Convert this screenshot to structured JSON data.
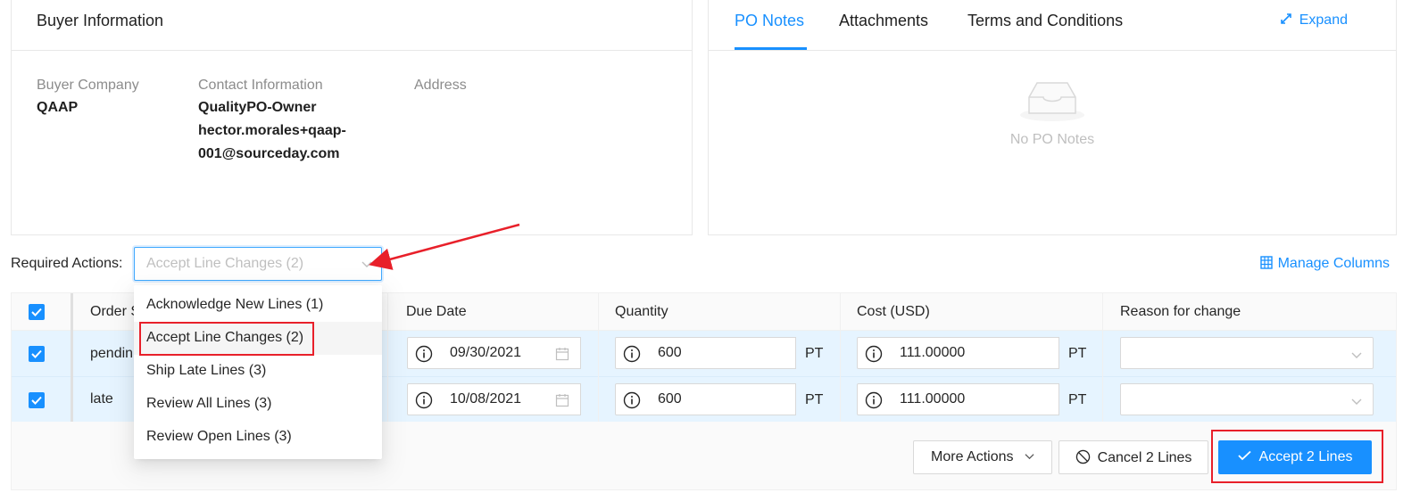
{
  "buyer": {
    "title": "Buyer Information",
    "company_label": "Buyer Company",
    "company_value": "QAAP",
    "contact_label": "Contact Information",
    "contact_name": "QualityPO-Owner",
    "contact_email_1": "hector.morales+qaap-",
    "contact_email_2": "001@sourceday.com",
    "address_label": "Address"
  },
  "notes": {
    "tabs": [
      {
        "label": "PO Notes",
        "active": true
      },
      {
        "label": "Attachments",
        "active": false
      },
      {
        "label": "Terms and Conditions",
        "active": false
      }
    ],
    "expand_label": "Expand",
    "empty_text": "No PO Notes"
  },
  "required_actions": {
    "label": "Required Actions:",
    "placeholder": "Accept Line Changes (2)",
    "options": [
      "Acknowledge New Lines (1)",
      "Accept Line Changes (2)",
      "Ship Late Lines (3)",
      "Review All Lines (3)",
      "Review Open Lines (3)"
    ],
    "highlighted_option": "Accept Line Changes (2)"
  },
  "manage_columns_label": "Manage Columns",
  "table": {
    "headers": {
      "order_status": "Order S",
      "due_date": "Due Date",
      "quantity": "Quantity",
      "cost": "Cost (USD)",
      "reason": "Reason for change"
    },
    "rows": [
      {
        "status": "pendin",
        "due_date": "09/30/2021",
        "quantity": "600",
        "qty_unit": "PT",
        "cost": "111.00000",
        "cost_unit": "PT",
        "checked": true
      },
      {
        "status": "late",
        "due_date": "10/08/2021",
        "quantity": "600",
        "qty_unit": "PT",
        "cost": "111.00000",
        "cost_unit": "PT",
        "checked": true
      }
    ]
  },
  "actions": {
    "more": "More Actions",
    "cancel": "Cancel 2 Lines",
    "accept": "Accept 2 Lines"
  },
  "colors": {
    "primary": "#1890ff",
    "row_selected": "#e6f4ff",
    "annotation": "#e8202a"
  }
}
